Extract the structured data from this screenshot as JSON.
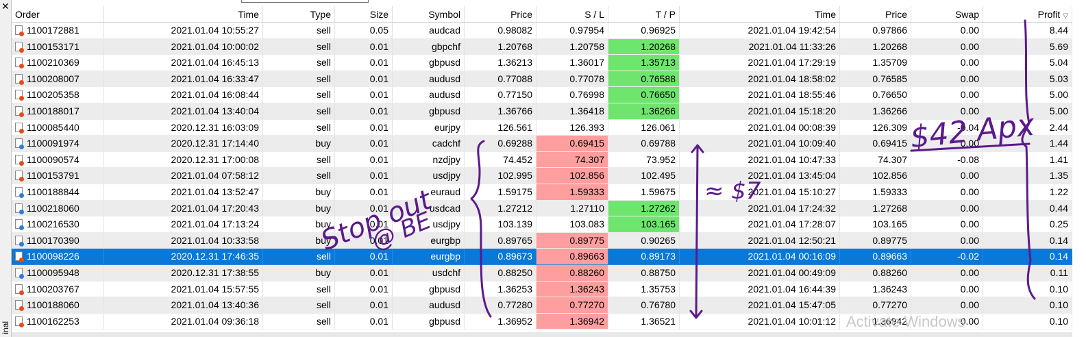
{
  "window": {
    "close_glyph": "✕",
    "side_label": "inal"
  },
  "columns": [
    "Order",
    "Time",
    "Type",
    "Size",
    "Symbol",
    "Price",
    "S / L",
    "T / P",
    "Time",
    "Price",
    "Swap",
    "Profit"
  ],
  "sort_glyph": "▽",
  "rows": [
    {
      "order": "1100172881",
      "time": "2021.01.04 10:55:27",
      "type": "sell",
      "size": "0.05",
      "symbol": "audcad",
      "price": "0.98082",
      "sl": "0.97954",
      "tp": "0.96925",
      "ctime": "2021.01.04 19:42:54",
      "cprice": "0.97866",
      "swap": "0.00",
      "profit": "8.44",
      "hl": ""
    },
    {
      "order": "1100153171",
      "time": "2021.01.04 10:00:02",
      "type": "sell",
      "size": "0.01",
      "symbol": "gbpchf",
      "price": "1.20768",
      "sl": "1.20758",
      "tp": "1.20268",
      "ctime": "2021.01.04 11:33:26",
      "cprice": "1.20268",
      "swap": "0.00",
      "profit": "5.69",
      "hl": "tp"
    },
    {
      "order": "1100210369",
      "time": "2021.01.04 16:45:13",
      "type": "sell",
      "size": "0.01",
      "symbol": "gbpusd",
      "price": "1.36213",
      "sl": "1.36017",
      "tp": "1.35713",
      "ctime": "2021.01.04 17:29:19",
      "cprice": "1.35709",
      "swap": "0.00",
      "profit": "5.04",
      "hl": "tp"
    },
    {
      "order": "1100208007",
      "time": "2021.01.04 16:33:47",
      "type": "sell",
      "size": "0.01",
      "symbol": "audusd",
      "price": "0.77088",
      "sl": "0.77078",
      "tp": "0.76588",
      "ctime": "2021.01.04 18:58:02",
      "cprice": "0.76585",
      "swap": "0.00",
      "profit": "5.03",
      "hl": "tp"
    },
    {
      "order": "1100205358",
      "time": "2021.01.04 16:08:44",
      "type": "sell",
      "size": "0.01",
      "symbol": "audusd",
      "price": "0.77150",
      "sl": "0.76998",
      "tp": "0.76650",
      "ctime": "2021.01.04 18:55:46",
      "cprice": "0.76650",
      "swap": "0.00",
      "profit": "5.00",
      "hl": "tp"
    },
    {
      "order": "1100188017",
      "time": "2021.01.04 13:40:04",
      "type": "sell",
      "size": "0.01",
      "symbol": "gbpusd",
      "price": "1.36766",
      "sl": "1.36418",
      "tp": "1.36266",
      "ctime": "2021.01.04 15:18:20",
      "cprice": "1.36266",
      "swap": "0.00",
      "profit": "5.00",
      "hl": "tp"
    },
    {
      "order": "1100085440",
      "time": "2020.12.31 16:03:09",
      "type": "sell",
      "size": "0.01",
      "symbol": "eurjpy",
      "price": "126.561",
      "sl": "126.393",
      "tp": "126.061",
      "ctime": "2021.01.04 00:08:39",
      "cprice": "126.309",
      "swap": "-0.04",
      "profit": "2.44",
      "hl": ""
    },
    {
      "order": "1100091974",
      "time": "2020.12.31 17:14:40",
      "type": "buy",
      "size": "0.01",
      "symbol": "cadchf",
      "price": "0.69288",
      "sl": "0.69415",
      "tp": "0.69788",
      "ctime": "2021.01.04 10:09:40",
      "cprice": "0.69415",
      "swap": "0.00",
      "profit": "1.44",
      "hl": "sl"
    },
    {
      "order": "1100090574",
      "time": "2020.12.31 17:00:08",
      "type": "sell",
      "size": "0.01",
      "symbol": "nzdjpy",
      "price": "74.452",
      "sl": "74.307",
      "tp": "73.952",
      "ctime": "2021.01.04 10:47:33",
      "cprice": "74.307",
      "swap": "-0.08",
      "profit": "1.41",
      "hl": "sl"
    },
    {
      "order": "1100153791",
      "time": "2021.01.04 07:58:12",
      "type": "sell",
      "size": "0.01",
      "symbol": "usdjpy",
      "price": "102.995",
      "sl": "102.856",
      "tp": "102.495",
      "ctime": "2021.01.04 13:45:04",
      "cprice": "102.856",
      "swap": "0.00",
      "profit": "1.35",
      "hl": "sl"
    },
    {
      "order": "1100188844",
      "time": "2021.01.04 13:52:47",
      "type": "buy",
      "size": "0.01",
      "symbol": "euraud",
      "price": "1.59175",
      "sl": "1.59333",
      "tp": "1.59675",
      "ctime": "2021.01.04 15:10:27",
      "cprice": "1.59333",
      "swap": "0.00",
      "profit": "1.22",
      "hl": "sl"
    },
    {
      "order": "1100218060",
      "time": "2021.01.04 17:20:43",
      "type": "buy",
      "size": "0.01",
      "symbol": "usdcad",
      "price": "1.27212",
      "sl": "1.27110",
      "tp": "1.27262",
      "ctime": "2021.01.04 17:24:32",
      "cprice": "1.27268",
      "swap": "0.00",
      "profit": "0.44",
      "hl": "tp"
    },
    {
      "order": "1100216530",
      "time": "2021.01.04 17:13:24",
      "type": "buy",
      "size": "0.01",
      "symbol": "usdjpy",
      "price": "103.139",
      "sl": "103.083",
      "tp": "103.165",
      "ctime": "2021.01.04 17:28:07",
      "cprice": "103.165",
      "swap": "0.00",
      "profit": "0.25",
      "hl": "tp"
    },
    {
      "order": "1100170390",
      "time": "2021.01.04 10:33:58",
      "type": "buy",
      "size": "0.01",
      "symbol": "eurgbp",
      "price": "0.89765",
      "sl": "0.89775",
      "tp": "0.90265",
      "ctime": "2021.01.04 12:50:21",
      "cprice": "0.89775",
      "swap": "0.00",
      "profit": "0.14",
      "hl": "sl"
    },
    {
      "order": "1100098226",
      "time": "2020.12.31 17:46:35",
      "type": "sell",
      "size": "0.01",
      "symbol": "eurgbp",
      "price": "0.89673",
      "sl": "0.89663",
      "tp": "0.89173",
      "ctime": "2021.01.04 00:16:09",
      "cprice": "0.89663",
      "swap": "-0.02",
      "profit": "0.14",
      "hl": "sl",
      "selected": true
    },
    {
      "order": "1100095948",
      "time": "2020.12.31 17:38:55",
      "type": "buy",
      "size": "0.01",
      "symbol": "usdchf",
      "price": "0.88250",
      "sl": "0.88260",
      "tp": "0.88750",
      "ctime": "2021.01.04 00:49:09",
      "cprice": "0.88260",
      "swap": "0.00",
      "profit": "0.11",
      "hl": "sl"
    },
    {
      "order": "1100203767",
      "time": "2021.01.04 15:57:55",
      "type": "sell",
      "size": "0.01",
      "symbol": "gbpusd",
      "price": "1.36253",
      "sl": "1.36243",
      "tp": "1.35753",
      "ctime": "2021.01.04 16:44:39",
      "cprice": "1.36243",
      "swap": "0.00",
      "profit": "0.10",
      "hl": "sl"
    },
    {
      "order": "1100188060",
      "time": "2021.01.04 13:40:36",
      "type": "sell",
      "size": "0.01",
      "symbol": "audusd",
      "price": "0.77280",
      "sl": "0.77270",
      "tp": "0.76780",
      "ctime": "2021.01.04 15:47:05",
      "cprice": "0.77270",
      "swap": "0.00",
      "profit": "0.10",
      "hl": "sl"
    },
    {
      "order": "1100162253",
      "time": "2021.01.04 09:36:18",
      "type": "sell",
      "size": "0.01",
      "symbol": "gbpusd",
      "price": "1.36952",
      "sl": "1.36942",
      "tp": "1.36521",
      "ctime": "2021.01.04 10:01:12",
      "cprice": "1.36942",
      "swap": "0.00",
      "profit": "0.10",
      "hl": "sl"
    }
  ],
  "annotations": {
    "left_text_1": "Stop out",
    "left_text_2": "@ BE",
    "mid_text": "≈ $7",
    "right_text": "$42 Apx"
  },
  "watermark": "Activate Windows",
  "colors": {
    "tp_hit": "#6ee66e",
    "sl_hit": "#ff9e9e",
    "selected": "#0a78d7",
    "ink": "#5b1a8c"
  }
}
